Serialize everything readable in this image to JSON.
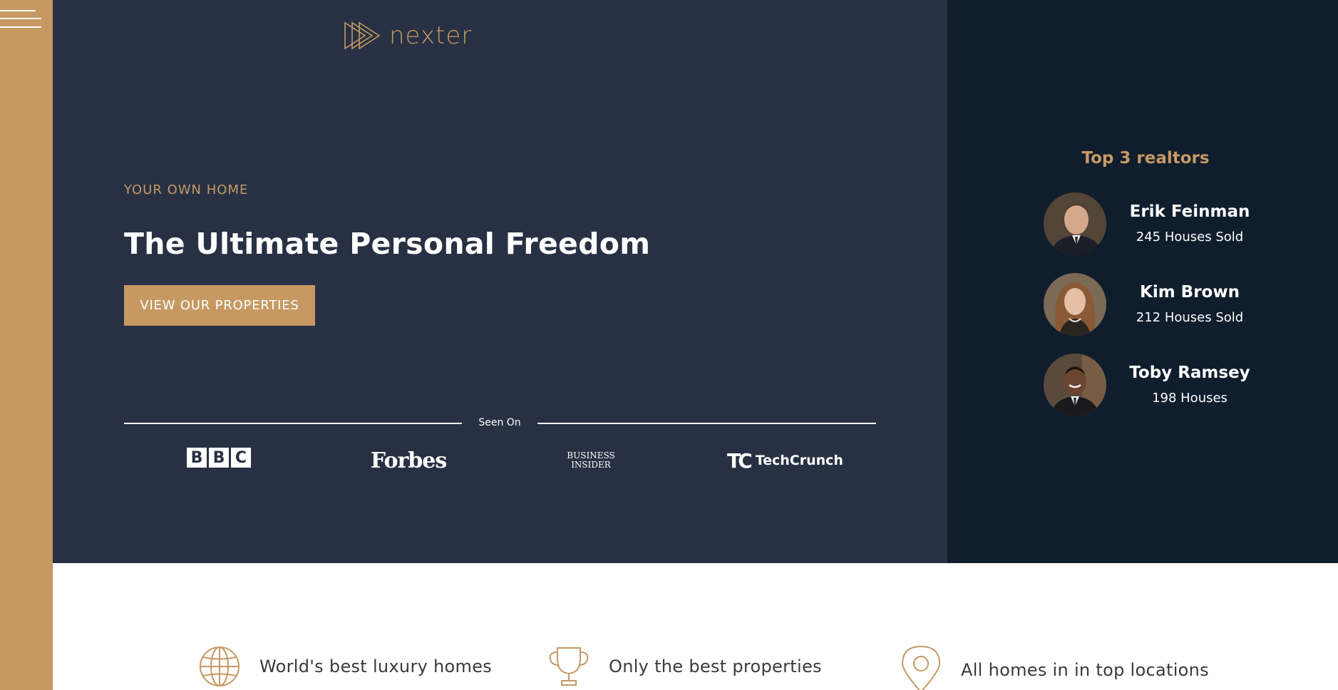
{
  "nav": {
    "menu_icon": "hamburger-menu-icon"
  },
  "logo": {
    "text": "nexter",
    "icon": "triple-play-triangle-icon"
  },
  "hero": {
    "eyebrow": "YOUR OWN HOME",
    "headline": "The Ultimate Personal Freedom",
    "cta": "VIEW OUR PROPERTIES"
  },
  "seen_on": {
    "label": "Seen On",
    "outlets": [
      {
        "name": "BBC",
        "letters": [
          "B",
          "B",
          "C"
        ]
      },
      {
        "name": "Forbes"
      },
      {
        "name": "Business Insider",
        "line1": "BUSINESS",
        "line2": "INSIDER"
      },
      {
        "name": "TechCrunch",
        "mark": "TC",
        "text": "TechCrunch"
      }
    ]
  },
  "realtors": {
    "title": "Top 3 realtors",
    "items": [
      {
        "name": "Erik Feinman",
        "sold": "245 Houses Sold"
      },
      {
        "name": "Kim Brown",
        "sold": "212 Houses Sold"
      },
      {
        "name": "Toby Ramsey",
        "sold": "198 Houses"
      }
    ]
  },
  "features": [
    {
      "icon": "globe-icon",
      "text": "World's best luxury homes"
    },
    {
      "icon": "trophy-icon",
      "text": "Only the best properties"
    },
    {
      "icon": "map-pin-icon",
      "text": "All homes in in top locations"
    }
  ],
  "colors": {
    "accent": "#c69963",
    "hero_bg": "#273143",
    "realtors_bg": "#101d2c",
    "white": "#ffffff"
  }
}
